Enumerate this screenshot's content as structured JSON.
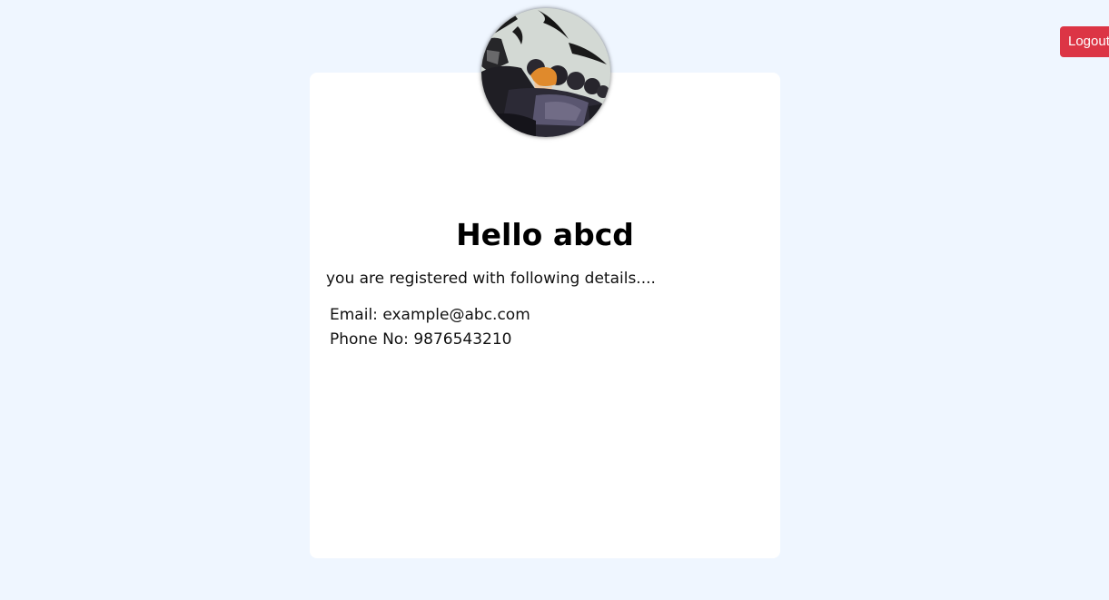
{
  "header": {
    "logout_label": "Logout",
    "logout_color": "#dc3545"
  },
  "profile": {
    "avatar_icon": "profile-photo",
    "greeting_prefix": "Hello",
    "username": "abcd",
    "intro_text": "you are registered with following details....",
    "email_label": "Email:",
    "email_value": "example@abc.com",
    "phone_label": "Phone No:",
    "phone_value": "9876543210"
  },
  "colors": {
    "background": "#eff6ff",
    "card": "#ffffff"
  }
}
